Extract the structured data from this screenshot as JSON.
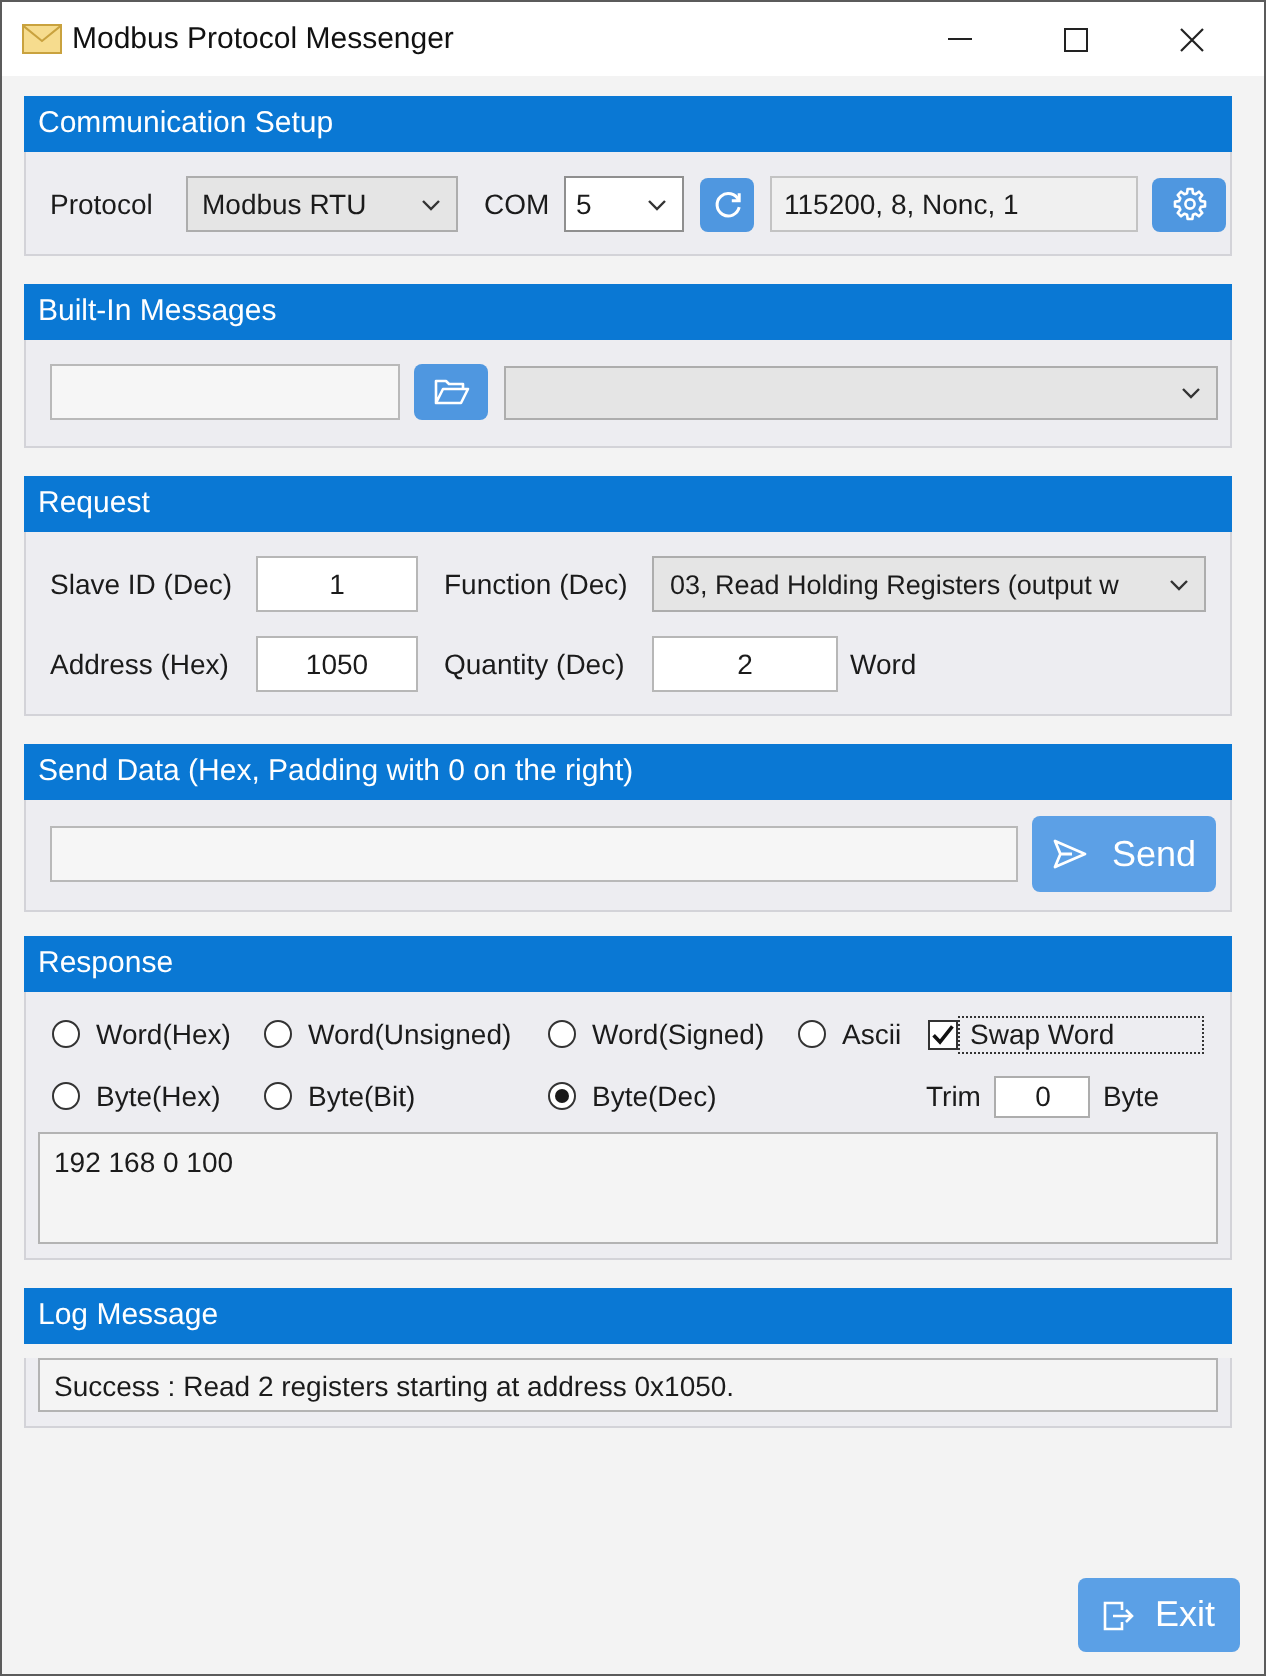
{
  "window": {
    "title": "Modbus Protocol Messenger"
  },
  "communication_setup": {
    "title": "Communication Setup",
    "protocol_label": "Protocol",
    "protocol": "Modbus RTU",
    "com_label": "COM",
    "com_port": "5",
    "port_settings": "115200, 8, Nonc, 1"
  },
  "built_in_messages": {
    "title": "Built-In Messages"
  },
  "request": {
    "title": "Request",
    "slave_id_label": "Slave ID (Dec)",
    "slave_id": "1",
    "function_label": "Function (Dec)",
    "function": "03, Read Holding Registers (output w",
    "address_label": "Address (Hex)",
    "address": "1050",
    "quantity_label": "Quantity (Dec)",
    "quantity": "2",
    "quantity_unit": "Word"
  },
  "send_data": {
    "title": "Send Data (Hex, Padding with 0 on the right)",
    "send_button": "Send"
  },
  "response": {
    "title": "Response",
    "formats": [
      {
        "label": "Word(Hex)",
        "selected": false
      },
      {
        "label": "Word(Unsigned)",
        "selected": false
      },
      {
        "label": "Word(Signed)",
        "selected": false
      },
      {
        "label": "Ascii",
        "selected": false
      },
      {
        "label": "Byte(Hex)",
        "selected": false
      },
      {
        "label": "Byte(Bit)",
        "selected": false
      },
      {
        "label": "Byte(Dec)",
        "selected": true
      }
    ],
    "swap_word": {
      "label": "Swap Word",
      "checked": true,
      "focused": true
    },
    "trim_label": "Trim",
    "trim": "0",
    "trim_unit": "Byte",
    "output": "192 168 0 100"
  },
  "log_message": {
    "title": "Log Message",
    "text": "Success : Read 2 registers starting at address 0x1050."
  },
  "exit_button": "Exit"
}
